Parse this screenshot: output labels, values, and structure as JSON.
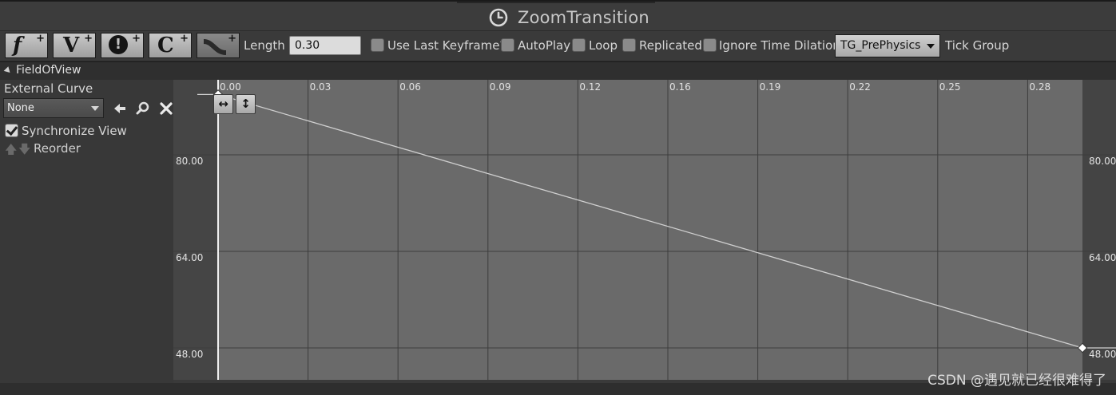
{
  "window": {
    "title": "ZoomTransition",
    "title_icon": "clock-icon"
  },
  "toolbar": {
    "buttons": [
      {
        "glyph": "f",
        "icon": "add-float-track-icon"
      },
      {
        "glyph": "V",
        "icon": "add-vector-track-icon"
      },
      {
        "glyph": "!",
        "icon": "add-event-track-icon"
      },
      {
        "glyph": "C",
        "icon": "add-color-track-icon"
      },
      {
        "glyph": "",
        "icon": "add-curve-asset-icon",
        "disabled": true
      }
    ],
    "length_label": "Length",
    "length_value": "0.30",
    "use_last_keyframe_label": "Use Last Keyframe?",
    "autoplay_label": "AutoPlay",
    "loop_label": "Loop",
    "replicated_label": "Replicated",
    "ignore_time_dilation_label": "Ignore Time Dilation",
    "tick_group_value": "TG_PrePhysics",
    "tick_group_label": "Tick Group"
  },
  "track": {
    "name": "FieldOfView",
    "external_curve_label": "External Curve",
    "external_curve_value": "None",
    "icons": [
      "use-selected-asset-icon",
      "browse-asset-icon",
      "clear-icon"
    ],
    "synchronize_view_label": "Synchronize View",
    "synchronize_view_checked": true,
    "reorder_label": "Reorder"
  },
  "curve_editor": {
    "x_ticks": [
      "0.00",
      "0.03",
      "0.06",
      "0.09",
      "0.12",
      "0.16",
      "0.19",
      "0.22",
      "0.25",
      "0.28"
    ],
    "y_ticks": [
      "80.00",
      "64.00",
      "48.00"
    ],
    "x_range": [
      0.0,
      0.3
    ],
    "key_points": [
      {
        "t": 0.0,
        "v": 90.0
      },
      {
        "t": 0.3,
        "v": 48.0
      }
    ],
    "zoom_buttons": [
      "fit-horizontal-icon",
      "fit-vertical-icon"
    ]
  },
  "colors": {
    "graph_bg": "#6a6a6a",
    "outside_range": "#444444",
    "curve": "#cfcfcf",
    "grid": "#3d3d3d"
  },
  "watermark": "CSDN @遇见就已经很难得了"
}
